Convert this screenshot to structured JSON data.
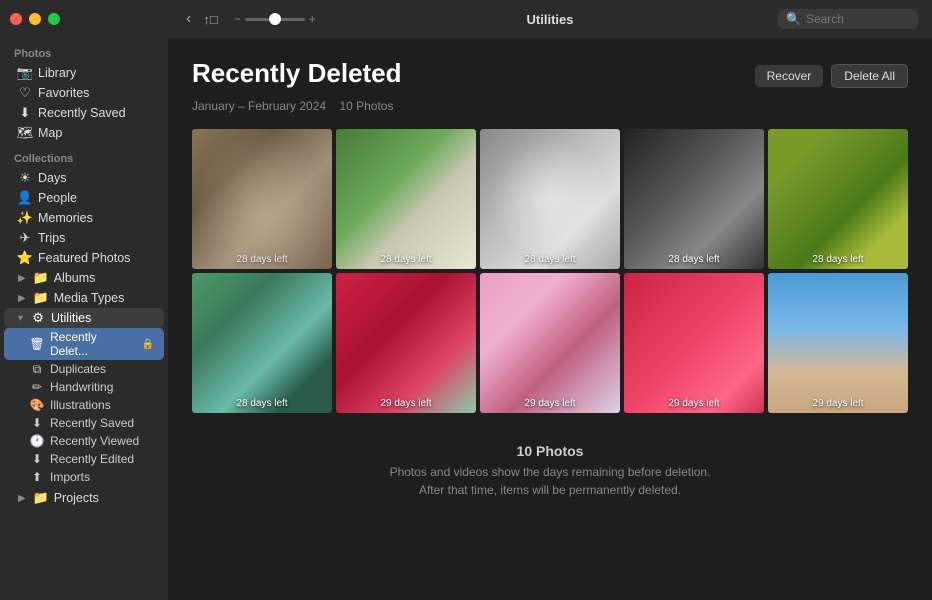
{
  "window": {
    "title": "Utilities"
  },
  "sidebar": {
    "photos_label": "Photos",
    "collections_label": "Collections",
    "items_photos": [
      {
        "id": "library",
        "label": "Library",
        "icon": "📷"
      },
      {
        "id": "favorites",
        "label": "Favorites",
        "icon": "♡"
      },
      {
        "id": "recently-saved",
        "label": "Recently Saved",
        "icon": "⬇"
      },
      {
        "id": "map",
        "label": "Map",
        "icon": "🗺"
      }
    ],
    "items_collections": [
      {
        "id": "days",
        "label": "Days",
        "icon": "☀"
      },
      {
        "id": "people",
        "label": "People",
        "icon": "👤"
      },
      {
        "id": "memories",
        "label": "Memories",
        "icon": "✨"
      },
      {
        "id": "trips",
        "label": "Trips",
        "icon": "✈"
      },
      {
        "id": "featured-photos",
        "label": "Featured Photos",
        "icon": "⭐"
      },
      {
        "id": "albums",
        "label": "Albums",
        "icon": "📁",
        "disclosure": "▶"
      },
      {
        "id": "media-types",
        "label": "Media Types",
        "icon": "📁",
        "disclosure": "▶"
      },
      {
        "id": "utilities",
        "label": "Utilities",
        "icon": "⚙",
        "disclosure": "▾",
        "expanded": true
      }
    ],
    "utilities_sub": [
      {
        "id": "recently-deleted",
        "label": "Recently Delet...",
        "icon": "🗑",
        "active": true
      },
      {
        "id": "duplicates",
        "label": "Duplicates",
        "icon": "⧉"
      },
      {
        "id": "handwriting",
        "label": "Handwriting",
        "icon": "✏"
      },
      {
        "id": "illustrations",
        "label": "Illustrations",
        "icon": "🎨"
      },
      {
        "id": "recently-saved-sub",
        "label": "Recently Saved",
        "icon": "⬇"
      },
      {
        "id": "recently-viewed",
        "label": "Recently Viewed",
        "icon": "🕐"
      },
      {
        "id": "recently-edited",
        "label": "Recently Edited",
        "icon": "⬇"
      },
      {
        "id": "imports",
        "label": "Imports",
        "icon": "⬆"
      }
    ],
    "projects": {
      "label": "Projects",
      "disclosure": "▶"
    }
  },
  "toolbar": {
    "title": "Utilities",
    "search_placeholder": "Search",
    "back_icon": "‹",
    "share_icon": "↑□"
  },
  "main": {
    "page_title": "Recently Deleted",
    "date_range": "January – February 2024",
    "photo_count_header": "10 Photos",
    "recover_label": "Recover",
    "delete_all_label": "Delete All",
    "photos": [
      {
        "id": "p1",
        "class": "photo-dog1",
        "days": "28 days left"
      },
      {
        "id": "p2",
        "class": "photo-dog2",
        "days": "28 days left"
      },
      {
        "id": "p3",
        "class": "photo-dog3",
        "days": "28 days left"
      },
      {
        "id": "p4",
        "class": "photo-person1",
        "days": "28 days left"
      },
      {
        "id": "p5",
        "class": "photo-person2",
        "days": "28 days left"
      },
      {
        "id": "p6",
        "class": "photo-house",
        "days": "28 days left"
      },
      {
        "id": "p7",
        "class": "photo-berries1",
        "days": "29 days left"
      },
      {
        "id": "p8",
        "class": "photo-cake",
        "days": "29 days left"
      },
      {
        "id": "p9",
        "class": "photo-berries2",
        "days": "29 days left"
      },
      {
        "id": "p10",
        "class": "photo-beach",
        "days": "29 days left"
      }
    ],
    "footer": {
      "count": "10 Photos",
      "desc_line1": "Photos and videos show the days remaining before deletion.",
      "desc_line2": "After that time, items will be permanently deleted."
    }
  }
}
